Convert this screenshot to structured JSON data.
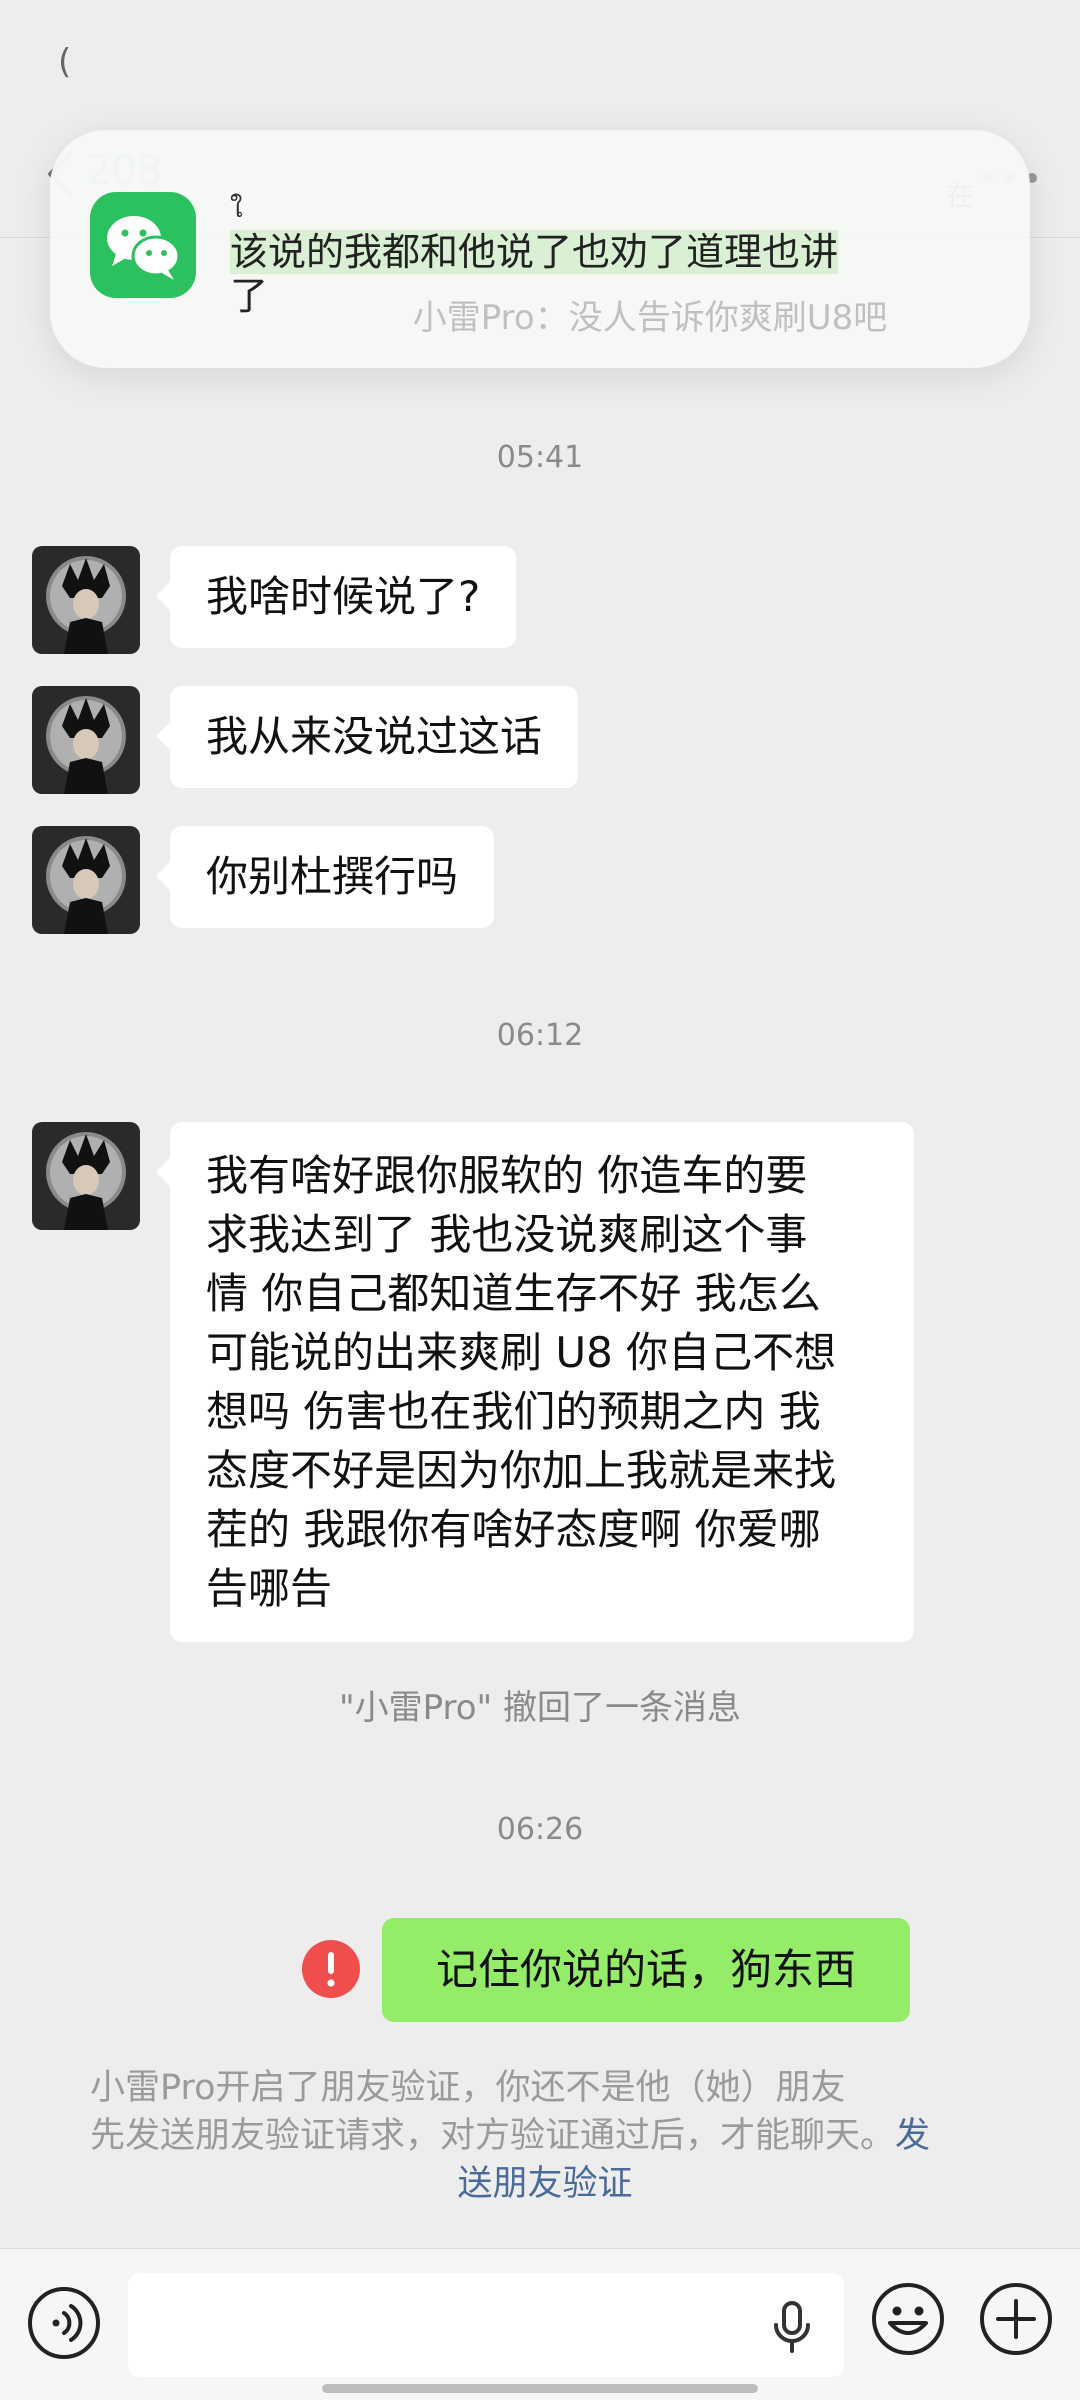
{
  "status": {
    "glyph": "("
  },
  "header": {
    "unread_count": "208",
    "right_text": "在"
  },
  "banner": {
    "sender": "ใ",
    "message": "该说的我都和他说了也劝了道理也讲了",
    "message_line1": "该说的我都和他说了也劝了道理也讲",
    "message_line2": "了",
    "subline": "小雷Pro：没人告诉你爽刷U8吧"
  },
  "chat": {
    "time1": "05:41",
    "msg1": "我啥时候说了?",
    "msg2": "我从来没说过这话",
    "msg3": "你别杜撰行吗",
    "time2": "06:12",
    "msg4": "我有啥好跟你服软的 你造车的要求我达到了 我也没说爽刷这个事情 你自己都知道生存不好 我怎么可能说的出来爽刷 U8 你自己不想想吗 伤害也在我们的预期之内 我态度不好是因为你加上我就是来找茬的 我跟你有啥好态度啊 你爱哪告哪告",
    "msg4_lines": [
      "我有啥好跟你服软的 你造车的要",
      "求我达到了 我也没说爽刷这个事",
      "情 你自己都知道生存不好 我怎么",
      "可能说的出来爽刷 U8 你自己不想",
      "想吗 伤害也在我们的预期之内 我",
      "态度不好是因为你加上我就是来找",
      "茬的 我跟你有啥好态度啊 你爱哪",
      "告哪告"
    ],
    "recall_note": "\"小雷Pro\" 撤回了一条消息",
    "time3": "06:26",
    "sent_msg": "记住你说的话，狗东西"
  },
  "system_notice": {
    "line1": "小雷Pro开启了朋友验证，你还不是他（她）朋友",
    "line2": "先发送朋友验证请求，对方验证通过后，才能聊天。",
    "link_part1": "发",
    "link_part2": "送朋友验证"
  },
  "input_bar": {
    "placeholder": ""
  },
  "icons": {
    "back": "chevron-left-icon",
    "more": "more-dots-icon",
    "app": "wechat-icon",
    "error": "error-exclamation-icon",
    "voice": "voice-icon",
    "mic": "microphone-icon",
    "emoji": "emoji-icon",
    "plus": "plus-icon"
  },
  "colors": {
    "background": "#ededed",
    "incoming_bubble": "#ffffff",
    "outgoing_bubble": "#95ec69",
    "wechat_green": "#2bc15f",
    "error_red": "#f04d4d",
    "link_blue": "#4a6a9a"
  }
}
